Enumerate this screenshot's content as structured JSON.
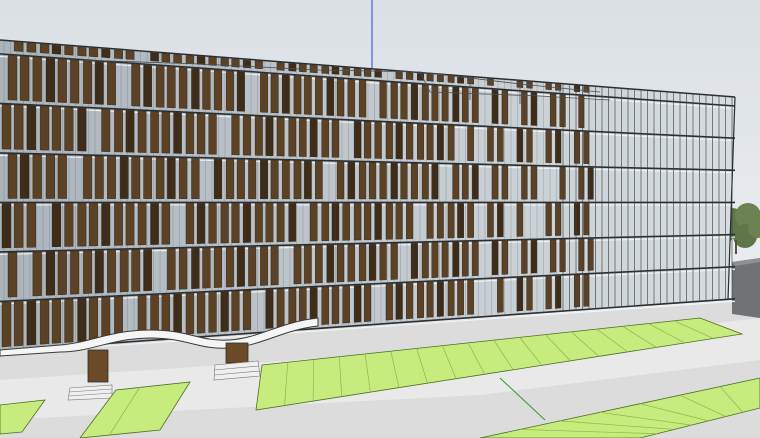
{
  "scene": {
    "description_label": "",
    "colors": {
      "sky_top": "#d9dee3",
      "sky_bottom": "#eef1f3",
      "facade_glass": "#c6ced4",
      "facade_glass_dark": "#8f9aa2",
      "mullion": "#2b2e30",
      "slat_brown": "#5c4124",
      "slat_brown_dark": "#3f2c18",
      "floor_band": "#e6e8ea",
      "canopy": "#f4f4f4",
      "door": "#6b4a28",
      "ground": "#d9d9d9",
      "lawn": "#c5ec7c",
      "lawn_line": "#8fb44f",
      "tree_green": "#6b7f55",
      "axis_blue": "#3340d6",
      "axis_green": "#2f9a3a",
      "annex": "#6f7375"
    },
    "elements": {
      "building": "office-building-facade",
      "left_wing": "brown-louvre-facade",
      "right_wing": "glass-frame-facade",
      "canopy": "entrance-canopy",
      "lawns": "lawn-panels",
      "trees": "background-trees",
      "axis": "model-axis-lines"
    }
  }
}
